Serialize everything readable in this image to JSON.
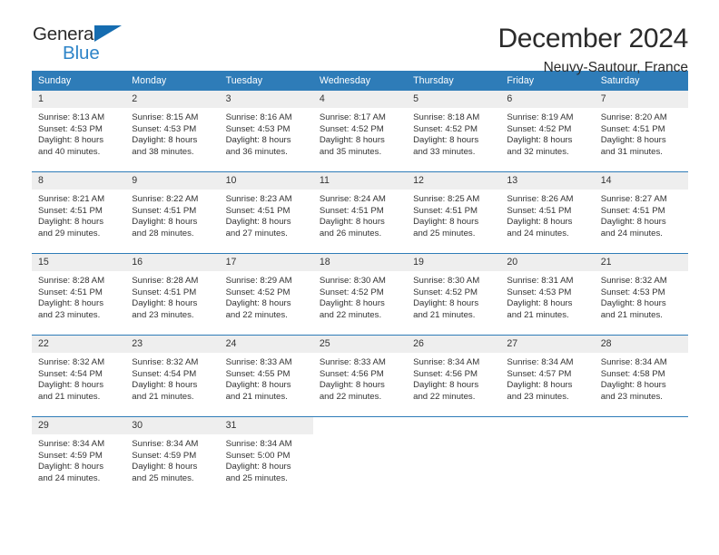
{
  "brand": {
    "name_dark": "General",
    "name_blue": "Blue",
    "accent_color": "#2e7cb8",
    "logo_triangle_color": "#156cb0"
  },
  "header": {
    "title": "December 2024",
    "location": "Neuvy-Sautour, France"
  },
  "calendar": {
    "weekday_headers": [
      "Sunday",
      "Monday",
      "Tuesday",
      "Wednesday",
      "Thursday",
      "Friday",
      "Saturday"
    ],
    "header_bg": "#2e7cb8",
    "header_text": "#ffffff",
    "daynum_bg": "#eeeeee",
    "weeks": [
      [
        {
          "day": "1",
          "sunrise": "Sunrise: 8:13 AM",
          "sunset": "Sunset: 4:53 PM",
          "daylight_1": "Daylight: 8 hours",
          "daylight_2": "and 40 minutes."
        },
        {
          "day": "2",
          "sunrise": "Sunrise: 8:15 AM",
          "sunset": "Sunset: 4:53 PM",
          "daylight_1": "Daylight: 8 hours",
          "daylight_2": "and 38 minutes."
        },
        {
          "day": "3",
          "sunrise": "Sunrise: 8:16 AM",
          "sunset": "Sunset: 4:53 PM",
          "daylight_1": "Daylight: 8 hours",
          "daylight_2": "and 36 minutes."
        },
        {
          "day": "4",
          "sunrise": "Sunrise: 8:17 AM",
          "sunset": "Sunset: 4:52 PM",
          "daylight_1": "Daylight: 8 hours",
          "daylight_2": "and 35 minutes."
        },
        {
          "day": "5",
          "sunrise": "Sunrise: 8:18 AM",
          "sunset": "Sunset: 4:52 PM",
          "daylight_1": "Daylight: 8 hours",
          "daylight_2": "and 33 minutes."
        },
        {
          "day": "6",
          "sunrise": "Sunrise: 8:19 AM",
          "sunset": "Sunset: 4:52 PM",
          "daylight_1": "Daylight: 8 hours",
          "daylight_2": "and 32 minutes."
        },
        {
          "day": "7",
          "sunrise": "Sunrise: 8:20 AM",
          "sunset": "Sunset: 4:51 PM",
          "daylight_1": "Daylight: 8 hours",
          "daylight_2": "and 31 minutes."
        }
      ],
      [
        {
          "day": "8",
          "sunrise": "Sunrise: 8:21 AM",
          "sunset": "Sunset: 4:51 PM",
          "daylight_1": "Daylight: 8 hours",
          "daylight_2": "and 29 minutes."
        },
        {
          "day": "9",
          "sunrise": "Sunrise: 8:22 AM",
          "sunset": "Sunset: 4:51 PM",
          "daylight_1": "Daylight: 8 hours",
          "daylight_2": "and 28 minutes."
        },
        {
          "day": "10",
          "sunrise": "Sunrise: 8:23 AM",
          "sunset": "Sunset: 4:51 PM",
          "daylight_1": "Daylight: 8 hours",
          "daylight_2": "and 27 minutes."
        },
        {
          "day": "11",
          "sunrise": "Sunrise: 8:24 AM",
          "sunset": "Sunset: 4:51 PM",
          "daylight_1": "Daylight: 8 hours",
          "daylight_2": "and 26 minutes."
        },
        {
          "day": "12",
          "sunrise": "Sunrise: 8:25 AM",
          "sunset": "Sunset: 4:51 PM",
          "daylight_1": "Daylight: 8 hours",
          "daylight_2": "and 25 minutes."
        },
        {
          "day": "13",
          "sunrise": "Sunrise: 8:26 AM",
          "sunset": "Sunset: 4:51 PM",
          "daylight_1": "Daylight: 8 hours",
          "daylight_2": "and 24 minutes."
        },
        {
          "day": "14",
          "sunrise": "Sunrise: 8:27 AM",
          "sunset": "Sunset: 4:51 PM",
          "daylight_1": "Daylight: 8 hours",
          "daylight_2": "and 24 minutes."
        }
      ],
      [
        {
          "day": "15",
          "sunrise": "Sunrise: 8:28 AM",
          "sunset": "Sunset: 4:51 PM",
          "daylight_1": "Daylight: 8 hours",
          "daylight_2": "and 23 minutes."
        },
        {
          "day": "16",
          "sunrise": "Sunrise: 8:28 AM",
          "sunset": "Sunset: 4:51 PM",
          "daylight_1": "Daylight: 8 hours",
          "daylight_2": "and 23 minutes."
        },
        {
          "day": "17",
          "sunrise": "Sunrise: 8:29 AM",
          "sunset": "Sunset: 4:52 PM",
          "daylight_1": "Daylight: 8 hours",
          "daylight_2": "and 22 minutes."
        },
        {
          "day": "18",
          "sunrise": "Sunrise: 8:30 AM",
          "sunset": "Sunset: 4:52 PM",
          "daylight_1": "Daylight: 8 hours",
          "daylight_2": "and 22 minutes."
        },
        {
          "day": "19",
          "sunrise": "Sunrise: 8:30 AM",
          "sunset": "Sunset: 4:52 PM",
          "daylight_1": "Daylight: 8 hours",
          "daylight_2": "and 21 minutes."
        },
        {
          "day": "20",
          "sunrise": "Sunrise: 8:31 AM",
          "sunset": "Sunset: 4:53 PM",
          "daylight_1": "Daylight: 8 hours",
          "daylight_2": "and 21 minutes."
        },
        {
          "day": "21",
          "sunrise": "Sunrise: 8:32 AM",
          "sunset": "Sunset: 4:53 PM",
          "daylight_1": "Daylight: 8 hours",
          "daylight_2": "and 21 minutes."
        }
      ],
      [
        {
          "day": "22",
          "sunrise": "Sunrise: 8:32 AM",
          "sunset": "Sunset: 4:54 PM",
          "daylight_1": "Daylight: 8 hours",
          "daylight_2": "and 21 minutes."
        },
        {
          "day": "23",
          "sunrise": "Sunrise: 8:32 AM",
          "sunset": "Sunset: 4:54 PM",
          "daylight_1": "Daylight: 8 hours",
          "daylight_2": "and 21 minutes."
        },
        {
          "day": "24",
          "sunrise": "Sunrise: 8:33 AM",
          "sunset": "Sunset: 4:55 PM",
          "daylight_1": "Daylight: 8 hours",
          "daylight_2": "and 21 minutes."
        },
        {
          "day": "25",
          "sunrise": "Sunrise: 8:33 AM",
          "sunset": "Sunset: 4:56 PM",
          "daylight_1": "Daylight: 8 hours",
          "daylight_2": "and 22 minutes."
        },
        {
          "day": "26",
          "sunrise": "Sunrise: 8:34 AM",
          "sunset": "Sunset: 4:56 PM",
          "daylight_1": "Daylight: 8 hours",
          "daylight_2": "and 22 minutes."
        },
        {
          "day": "27",
          "sunrise": "Sunrise: 8:34 AM",
          "sunset": "Sunset: 4:57 PM",
          "daylight_1": "Daylight: 8 hours",
          "daylight_2": "and 23 minutes."
        },
        {
          "day": "28",
          "sunrise": "Sunrise: 8:34 AM",
          "sunset": "Sunset: 4:58 PM",
          "daylight_1": "Daylight: 8 hours",
          "daylight_2": "and 23 minutes."
        }
      ],
      [
        {
          "day": "29",
          "sunrise": "Sunrise: 8:34 AM",
          "sunset": "Sunset: 4:59 PM",
          "daylight_1": "Daylight: 8 hours",
          "daylight_2": "and 24 minutes."
        },
        {
          "day": "30",
          "sunrise": "Sunrise: 8:34 AM",
          "sunset": "Sunset: 4:59 PM",
          "daylight_1": "Daylight: 8 hours",
          "daylight_2": "and 25 minutes."
        },
        {
          "day": "31",
          "sunrise": "Sunrise: 8:34 AM",
          "sunset": "Sunset: 5:00 PM",
          "daylight_1": "Daylight: 8 hours",
          "daylight_2": "and 25 minutes."
        },
        {
          "day": "",
          "sunrise": "",
          "sunset": "",
          "daylight_1": "",
          "daylight_2": ""
        },
        {
          "day": "",
          "sunrise": "",
          "sunset": "",
          "daylight_1": "",
          "daylight_2": ""
        },
        {
          "day": "",
          "sunrise": "",
          "sunset": "",
          "daylight_1": "",
          "daylight_2": ""
        },
        {
          "day": "",
          "sunrise": "",
          "sunset": "",
          "daylight_1": "",
          "daylight_2": ""
        }
      ]
    ]
  }
}
